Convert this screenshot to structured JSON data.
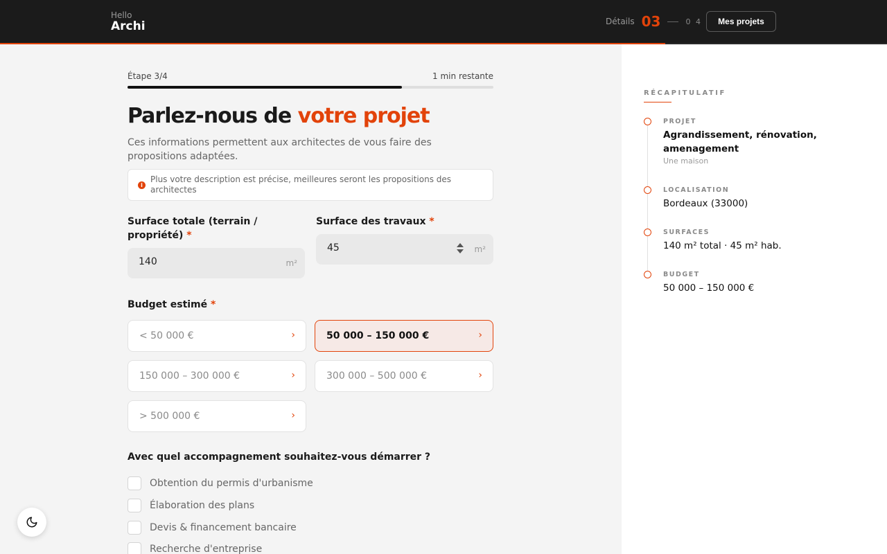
{
  "header": {
    "logo_small": "Hello",
    "logo_big": "Archi",
    "steps_label": "Détails",
    "step_current": "03",
    "step_total": "0 4",
    "projects_button": "Mes projets",
    "progress_fraction": 0.75
  },
  "form": {
    "step_text": "Étape 3/4",
    "time_left": "1 min restante",
    "progress_fraction": 0.75,
    "title_part1": "Parlez-nous de ",
    "title_accent": "votre projet",
    "intro": "Ces informations permettent aux architectes de vous faire des propositions adaptées.",
    "info_icon": "info-icon",
    "info_text": "Plus votre description est précise, meilleures seront les propositions des architectes",
    "surface_total": {
      "label": "Surface totale (terrain / propriété)",
      "required_mark": "*",
      "value": "140",
      "unit": "m²"
    },
    "surface_travaux": {
      "label": "Surface des travaux",
      "required_mark": "*",
      "value": "45",
      "unit": "m²"
    },
    "budget": {
      "label": "Budget estimé",
      "required_mark": "*",
      "chevron": "›",
      "options": [
        "< 50 000 €",
        "50 000 – 150 000 €",
        "150 000 – 300 000 €",
        "300 000 – 500 000 €",
        "> 500 000 €"
      ],
      "selected": "50 000 – 150 000 €"
    },
    "accompaniment": {
      "question": "Avec quel accompagnement souhaitez-vous démarrer ?",
      "options": [
        "Obtention du permis d'urbanisme",
        "Élaboration des plans",
        "Devis & financement bancaire",
        "Recherche d'entreprise"
      ]
    }
  },
  "recap": {
    "title": "RÉCAPITULATIF",
    "items": [
      {
        "label": "PROJET",
        "value": "Agrandissement, rénovation, amenagement",
        "sub": "Une maison"
      },
      {
        "label": "LOCALISATION",
        "value": "Bordeaux (33000)"
      },
      {
        "label": "SURFACES",
        "value": "140 m² total · 45 m² hab."
      },
      {
        "label": "BUDGET",
        "value": "50 000 – 150 000 €"
      }
    ]
  },
  "theme_toggle_icon": "moon-icon",
  "colors": {
    "accent": "#e2430a",
    "header_bg": "#1b1b1b",
    "page_bg": "#f4f4f4"
  }
}
